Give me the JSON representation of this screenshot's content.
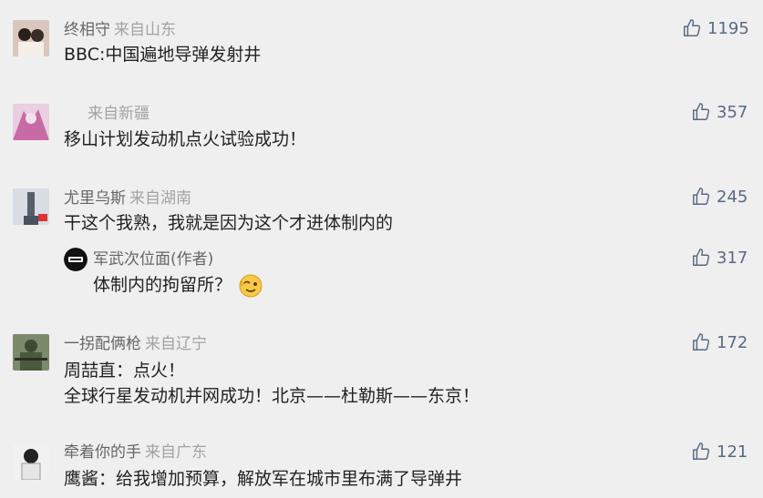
{
  "comments": [
    {
      "user": "终相守",
      "location": "来自山东",
      "text_lines": [
        "BBC:中国遍地导弹发射井"
      ],
      "likes": "1195"
    },
    {
      "user": "",
      "location": "来自新疆",
      "text_lines": [
        "移山计划发动机点火试验成功！"
      ],
      "likes": "357"
    },
    {
      "user": "尤里乌斯",
      "location": "来自湖南",
      "text_lines": [
        "干这个我熟，我就是因为这个才进体制内的"
      ],
      "likes": "245",
      "reply": {
        "user": "军武次位面",
        "role": "(作者)",
        "text": "体制内的拘留所？",
        "likes": "317"
      }
    },
    {
      "user": "一拐配俩枪",
      "location": "来自辽宁",
      "text_lines": [
        "周喆直：点火！",
        "全球行星发动机并网成功！北京——杜勒斯——东京！"
      ],
      "likes": "172"
    },
    {
      "user": "牵着你的手",
      "location": "来自广东",
      "text_lines": [
        "鹰酱：给我增加预算，解放军在城市里布满了导弹井"
      ],
      "likes": "121"
    }
  ],
  "icons": {
    "like": "thumbs-up-icon",
    "emoji": "winking-face-emoji"
  },
  "colors": {
    "background": "#efefef",
    "username": "#666666",
    "location": "#a3a3a3",
    "like": "#5a6a83",
    "text": "#222222"
  }
}
